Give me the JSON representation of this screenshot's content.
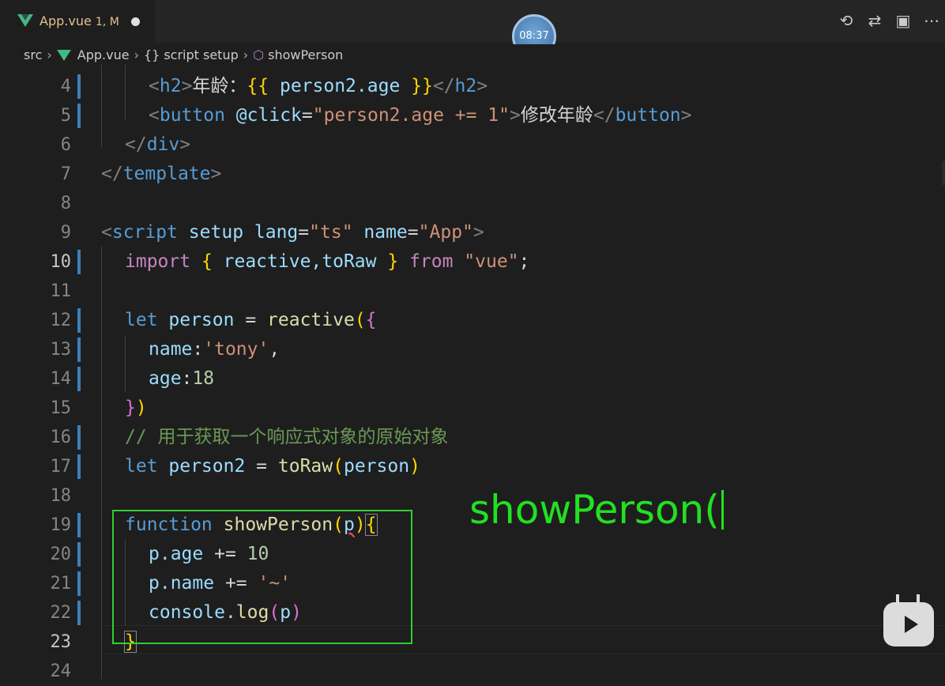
{
  "tab": {
    "file": "App.vue",
    "status": "1, M"
  },
  "timer": "08:37",
  "actions": {
    "history": "⟲",
    "compare": "⇄",
    "split": "▣",
    "more": "⋯"
  },
  "breadcrumb": {
    "src": "src",
    "file": "App.vue",
    "braces": "{}",
    "section": "script setup",
    "symbol": "showPerson"
  },
  "lines": [
    {
      "n": "4"
    },
    {
      "n": "5"
    },
    {
      "n": "6"
    },
    {
      "n": "7"
    },
    {
      "n": "8"
    },
    {
      "n": "9"
    },
    {
      "n": "10"
    },
    {
      "n": "11"
    },
    {
      "n": "12"
    },
    {
      "n": "13"
    },
    {
      "n": "14"
    },
    {
      "n": "15"
    },
    {
      "n": "16"
    },
    {
      "n": "17"
    },
    {
      "n": "18"
    },
    {
      "n": "19"
    },
    {
      "n": "20"
    },
    {
      "n": "21"
    },
    {
      "n": "22"
    },
    {
      "n": "23"
    },
    {
      "n": "24"
    }
  ],
  "code": {
    "l4": {
      "open": "<",
      "tag": "h2",
      "close": ">",
      "text": "年龄：",
      "o": "{{ ",
      "expr": "person2.age",
      "c": " }}",
      "etag_open": "</",
      "etag": "h2",
      "etag_close": ">"
    },
    "l5": {
      "open": "<",
      "tag": "button",
      "attr": " @click",
      "eq": "=",
      "val": "\"person2.age += 1\"",
      "close": ">",
      "text": "修改年龄",
      "etag_open": "</",
      "etag": "button",
      "etag_close": ">"
    },
    "l6": {
      "open": "</",
      "tag": "div",
      "close": ">"
    },
    "l7": {
      "open": "</",
      "tag": "template",
      "close": ">"
    },
    "l9": {
      "open": "<",
      "tag": "script",
      "a1": " setup",
      "a2": " lang",
      "eq": "=",
      "v2": "\"ts\"",
      "a3": " name",
      "eq2": "=",
      "v3": "\"App\"",
      "close": ">"
    },
    "l10": {
      "kw": "import",
      "ob": " { ",
      "names": "reactive,toRaw",
      "cb": " } ",
      "from": "from",
      "mod": " \"vue\"",
      "semi": ";"
    },
    "l12": {
      "kw": "let",
      "var": " person",
      "eq": " = ",
      "fn": "reactive",
      "p": "(",
      "b": "{"
    },
    "l13": {
      "key": "name",
      "colon": ":",
      "val": "'tony'",
      "comma": ","
    },
    "l14": {
      "key": "age",
      "colon": ":",
      "val": "18"
    },
    "l15": {
      "b": "}",
      "p": ")"
    },
    "l16": {
      "comment": "// 用于获取一个响应式对象的原始对象"
    },
    "l17": {
      "kw": "let",
      "var": " person2",
      "eq": " = ",
      "fn": "toRaw",
      "p1": "(",
      "arg": "person",
      "p2": ")"
    },
    "l19": {
      "kw": "function",
      "fn": " showPerson",
      "p1": "(",
      "arg": "p",
      "p2": ")",
      "b": "{"
    },
    "l20": {
      "obj": "p",
      "prop": ".age",
      "op": " += ",
      "val": "10"
    },
    "l21": {
      "obj": "p",
      "prop": ".name",
      "op": " += ",
      "val": "'~'"
    },
    "l22": {
      "obj": "console",
      "dot": ".",
      "fn": "log",
      "p1": "(",
      "arg": "p",
      "p2": ")"
    },
    "l23": {
      "b": "}"
    }
  },
  "overlay": "showPerson("
}
